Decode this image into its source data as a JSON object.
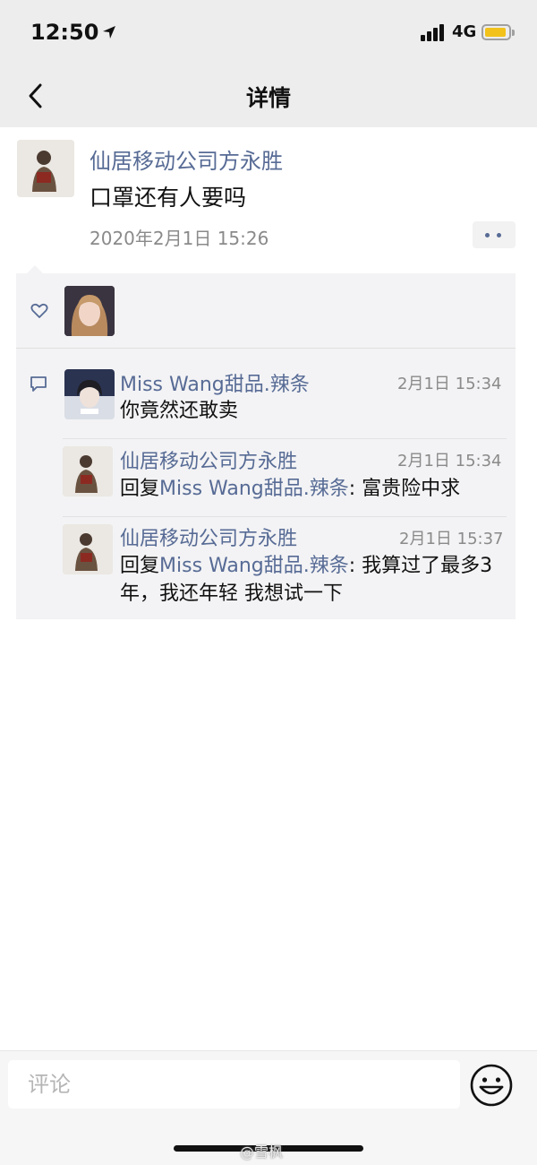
{
  "status_bar": {
    "time": "12:50",
    "location_glyph": "➚",
    "network": "4G"
  },
  "nav": {
    "title": "详情",
    "back_icon": "chevron-left-icon"
  },
  "post": {
    "author": "仙居移动公司方永胜",
    "text": "口罩还有人要吗",
    "time": "2020年2月1日 15:26",
    "more_icon": "ellipsis-icon"
  },
  "likes": {
    "icon": "heart-icon"
  },
  "comments": [
    {
      "name": "Miss Wang甜品.辣条",
      "time": "2月1日 15:34",
      "text": "你竟然还敢卖"
    },
    {
      "name": "仙居移动公司方永胜",
      "time": "2月1日 15:34",
      "reply_prefix": "回复",
      "reply_to": "Miss Wang甜品.辣条",
      "text": ": 富贵险中求"
    },
    {
      "name": "仙居移动公司方永胜",
      "time": "2月1日 15:37",
      "reply_prefix": "回复",
      "reply_to": "Miss Wang甜品.辣条",
      "text": ": 我算过了最多3年，我还年轻  我想试一下"
    }
  ],
  "comment_input": {
    "placeholder": "评论"
  },
  "watermark": "@雪枫",
  "colors": {
    "link": "#576b95",
    "panel": "#f3f3f5",
    "bar": "#ededed"
  }
}
